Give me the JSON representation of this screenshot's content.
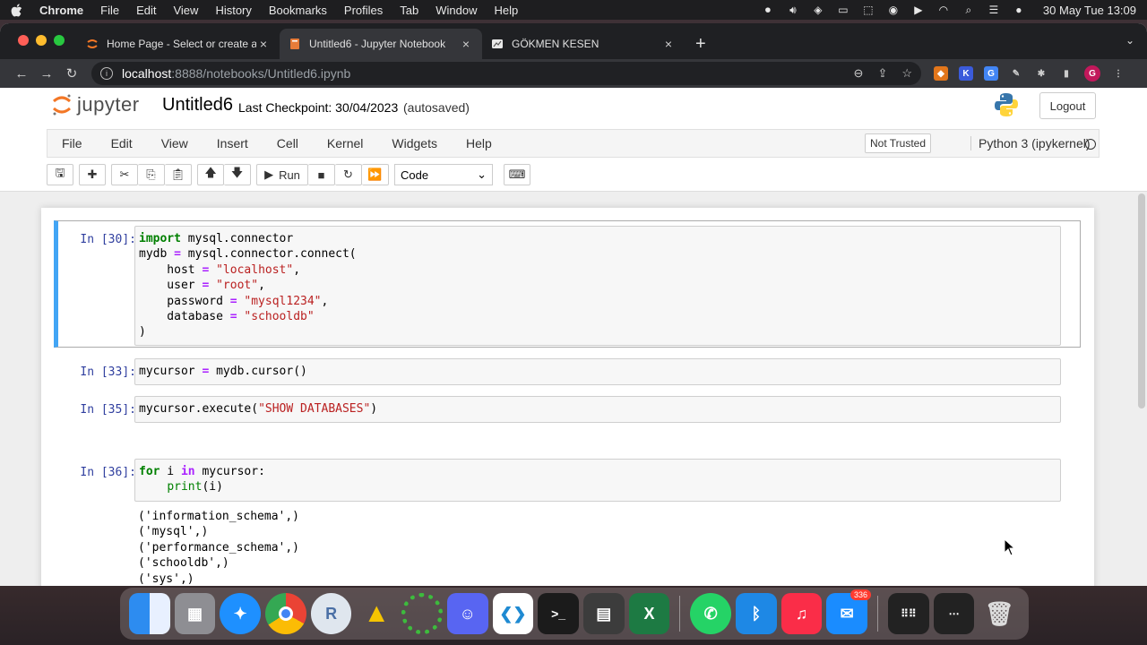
{
  "os_menubar": {
    "app": "Chrome",
    "items": [
      "File",
      "Edit",
      "View",
      "History",
      "Bookmarks",
      "Profiles",
      "Tab",
      "Window",
      "Help"
    ],
    "clock": "30 May Tue  13:09"
  },
  "browser": {
    "tabs": [
      {
        "title": "Home Page - Select or create a",
        "favicon": "jupyter-icon"
      },
      {
        "title": "Untitled6 - Jupyter Notebook",
        "favicon": "notebook-icon"
      },
      {
        "title": "GÖKMEN KESEN",
        "favicon": "page-icon"
      }
    ],
    "address": {
      "host": "localhost",
      "path": ":8888/notebooks/Untitled6.ipynb"
    },
    "profile_initial": "G"
  },
  "jupyter": {
    "logo_text": "jupyter",
    "notebook_name": "Untitled6",
    "checkpoint": "Last Checkpoint: 30/04/2023",
    "autosaved": "(autosaved)",
    "logout": "Logout",
    "menu": [
      "File",
      "Edit",
      "View",
      "Insert",
      "Cell",
      "Kernel",
      "Widgets",
      "Help"
    ],
    "trust": "Not Trusted",
    "kernel": "Python 3 (ipykernel)",
    "toolbar": {
      "run_label": "Run",
      "cell_type": "Code"
    }
  },
  "cells": [
    {
      "prompt": "In [30]:"
    },
    {
      "prompt": "In [33]:"
    },
    {
      "prompt": "In [35]:"
    },
    {
      "prompt": "In [36]:",
      "output": [
        "('information_schema',)",
        "('mysql',)",
        "('performance_schema',)",
        "('schooldb',)",
        "('sys',)"
      ]
    }
  ],
  "dock": {
    "mail_badge": "336",
    "icons": [
      "finder-icon",
      "launchpad-icon",
      "safari-icon",
      "chrome-icon",
      "r-icon",
      "archicad-icon",
      "progress-icon",
      "discord-icon",
      "vscode-icon",
      "terminal-icon",
      "activity-icon",
      "excel-icon",
      "whatsapp-icon",
      "bluetooth-icon",
      "music-icon",
      "mail-icon",
      "grid-icon",
      "screen-icon",
      "trash-icon"
    ]
  }
}
